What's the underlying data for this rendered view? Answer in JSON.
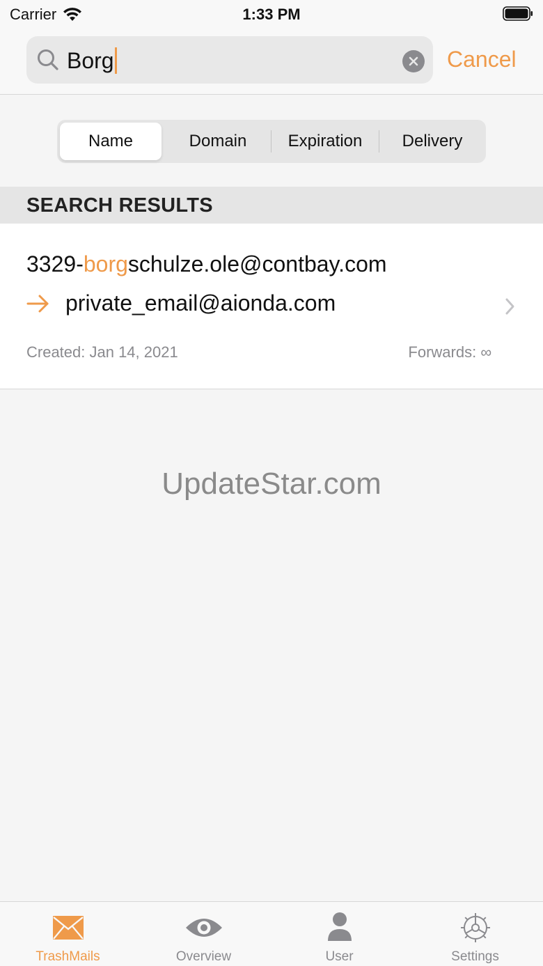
{
  "status_bar": {
    "carrier": "Carrier",
    "time": "1:33 PM"
  },
  "search": {
    "value": "Borg",
    "cancel_label": "Cancel"
  },
  "segments": [
    {
      "label": "Name",
      "active": true
    },
    {
      "label": "Domain",
      "active": false
    },
    {
      "label": "Expiration",
      "active": false
    },
    {
      "label": "Delivery",
      "active": false
    }
  ],
  "section": {
    "title": "SEARCH RESULTS"
  },
  "result": {
    "address_prefix": "3329-",
    "address_match": "borg",
    "address_suffix": "schulze.ole@contbay.com",
    "forward_to": "private_email@aionda.com",
    "created": "Created: Jan 14, 2021",
    "forwards": "Forwards: ∞"
  },
  "watermark": "UpdateStar.com",
  "tabs": [
    {
      "label": "TrashMails",
      "icon": "envelope-icon",
      "active": true
    },
    {
      "label": "Overview",
      "icon": "eye-icon",
      "active": false
    },
    {
      "label": "User",
      "icon": "person-icon",
      "active": false
    },
    {
      "label": "Settings",
      "icon": "gear-icon",
      "active": false
    }
  ],
  "colors": {
    "accent": "#ef9a4a",
    "secondary_text": "#8a8a8e",
    "background": "#f5f5f5"
  }
}
